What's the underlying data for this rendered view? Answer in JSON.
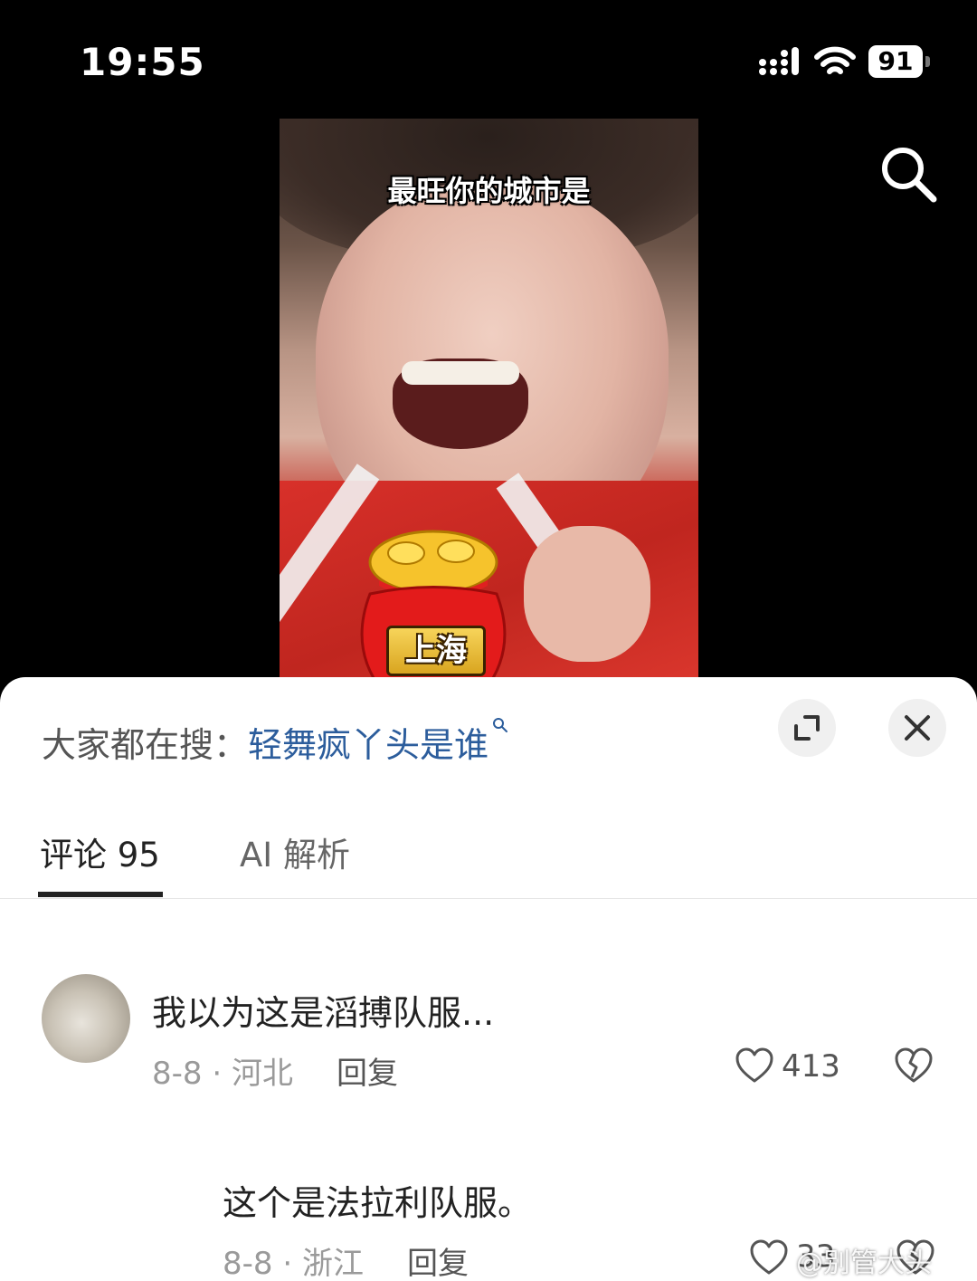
{
  "status_bar": {
    "time": "19:55",
    "battery": "91"
  },
  "video": {
    "caption": "最旺你的城市是",
    "bag_label": "上海"
  },
  "search_hint": {
    "prefix": "大家都在搜：",
    "query": "轻舞疯丫头是谁"
  },
  "tabs": [
    {
      "label": "评论 95",
      "active": true
    },
    {
      "label": "AI 解析",
      "active": false
    }
  ],
  "comments": [
    {
      "text": "我以为这是滔搏队服...",
      "meta": "8-8 · 河北",
      "reply": "回复",
      "likes": "413"
    },
    {
      "text": "这个是法拉利队服。",
      "meta": "8-8 · 浙江",
      "reply": "回复",
      "likes": "33"
    }
  ],
  "watermark": "@别管大头",
  "icons": {
    "search": "search-icon",
    "expand": "expand-icon",
    "close": "close-icon",
    "heart": "heart-icon",
    "dislike": "broken-heart-icon"
  }
}
